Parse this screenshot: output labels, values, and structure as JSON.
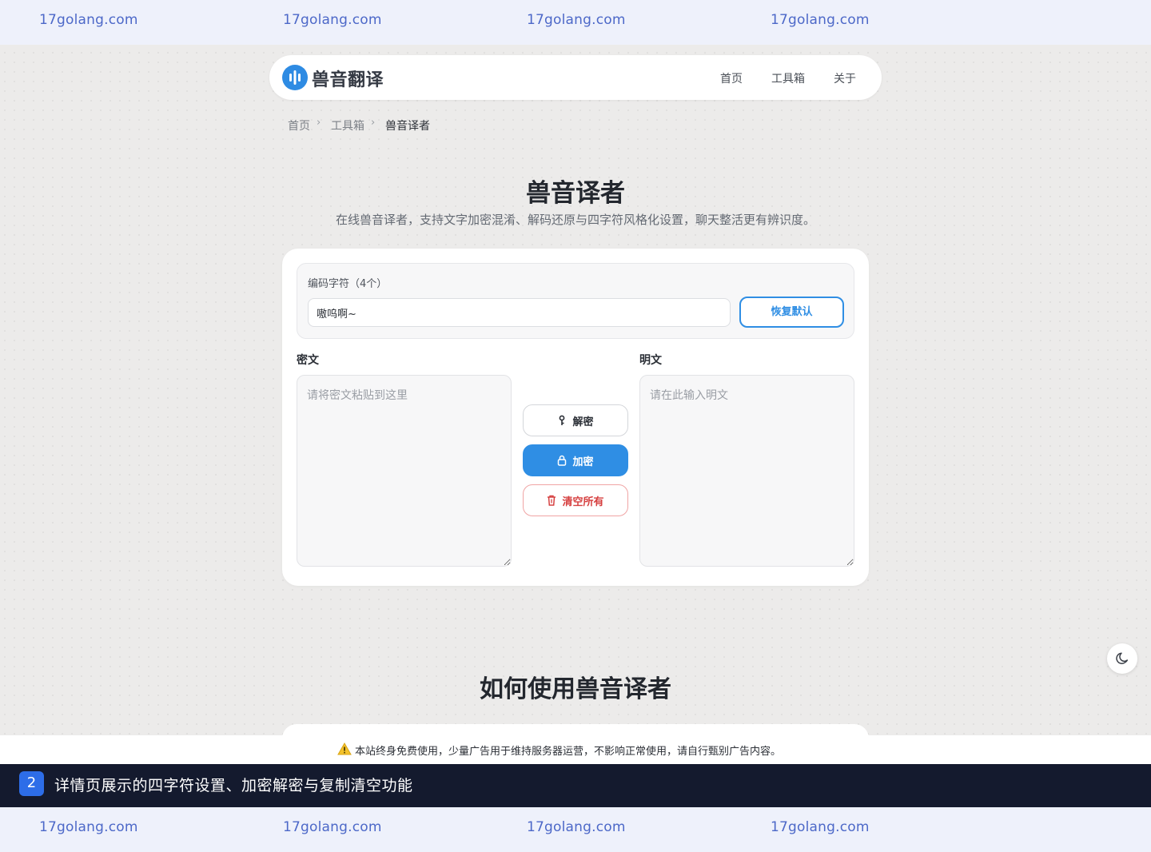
{
  "watermark": {
    "text": "17golang.com",
    "color": "#4c68c8"
  },
  "header": {
    "logo_text": "兽音翻译",
    "nav": [
      "首页",
      "工具箱",
      "关于"
    ]
  },
  "breadcrumb": [
    "首页",
    "工具箱",
    "兽音译者"
  ],
  "hero": {
    "title": "兽音译者",
    "subtitle": "在线兽音译者，支持文字加密混淆、解码还原与四字符风格化设置，聊天整活更有辨识度。"
  },
  "encoder": {
    "chars_label": "编码字符（4个）",
    "chars_value": "嗷呜啊~",
    "reset_label": "恢复默认",
    "cipher_label": "密文",
    "cipher_placeholder": "请将密文粘贴到这里",
    "plain_label": "明文",
    "plain_placeholder": "请在此输入明文",
    "decrypt_label": "解密",
    "encrypt_label": "加密",
    "clear_label": "清空所有"
  },
  "howto": {
    "title": "如何使用兽音译者"
  },
  "notice": {
    "text": "本站终身免费使用，少量广告用于维持服务器运营，不影响正常使用，请自行甄别广告内容。"
  },
  "caption": {
    "badge": "2",
    "text": "详情页展示的四字符设置、加密解密与复制清空功能"
  },
  "colors": {
    "accent": "#2f8ee4",
    "danger": "#d64040",
    "caption_bg": "#141a2e"
  }
}
